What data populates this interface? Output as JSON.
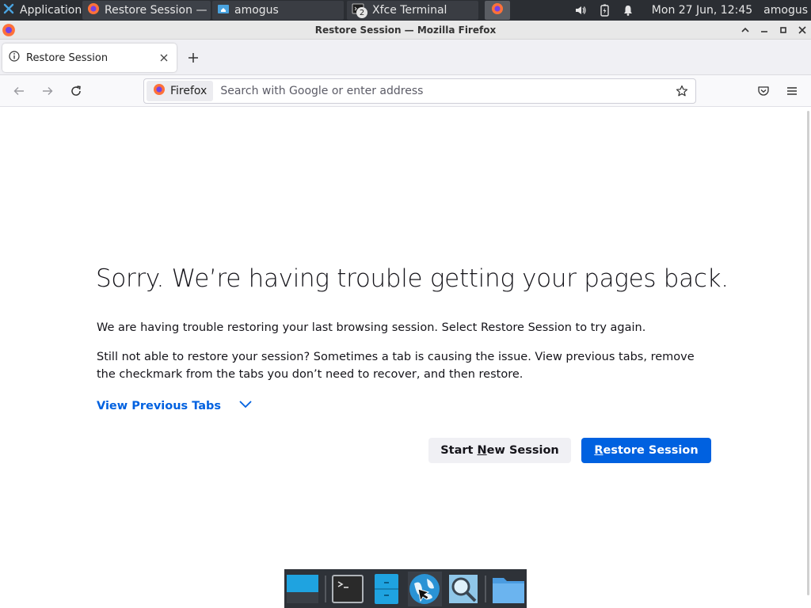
{
  "panel": {
    "apps_menu_label": "Applications",
    "tasks": [
      {
        "label": "Restore Session — ..."
      },
      {
        "label": "amogus"
      },
      {
        "label": "Xfce Terminal",
        "badge": "2"
      }
    ],
    "clock": "Mon 27 Jun, 12:45",
    "user": "amogus"
  },
  "window": {
    "title": "Restore Session — Mozilla Firefox"
  },
  "tabs": [
    {
      "label": "Restore Session"
    }
  ],
  "urlbar": {
    "identity_label": "Firefox",
    "placeholder": "Search with Google or enter address"
  },
  "page": {
    "heading": "Sorry. We’re having trouble getting your pages back.",
    "para1": "We are having trouble restoring your last browsing session. Select Restore Session to try again.",
    "para2": "Still not able to restore your session? Sometimes a tab is causing the issue. View previous tabs, remove the checkmark from the tabs you don’t need to recover, and then restore.",
    "view_tabs_label": "View Previous Tabs",
    "start_new": {
      "pre": "Start ",
      "key": "N",
      "post": "ew Session"
    },
    "restore": {
      "pre": "",
      "key": "R",
      "post": "estore Session"
    }
  },
  "colors": {
    "accent": "#0061e0",
    "panel_bg": "#2b2e33"
  }
}
